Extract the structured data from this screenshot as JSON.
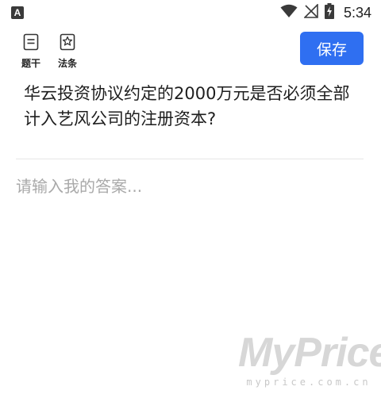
{
  "status_bar": {
    "notification_icon": "A",
    "time": "5:34",
    "icons": [
      "wifi-icon",
      "no-signal-icon",
      "battery-charging-icon"
    ]
  },
  "toolbar": {
    "tigan_label": "题干",
    "fatiao_label": "法条",
    "save_label": "保存"
  },
  "question": {
    "text": "华云投资协议约定的2000万元是否必须全部计入艺风公司的注册资本?"
  },
  "answer": {
    "placeholder": "请输入我的答案...",
    "value": ""
  },
  "watermark": {
    "main": "MyPrice",
    "sub": "myprice.com.cn"
  },
  "colors": {
    "accent": "#2f6ff1",
    "text": "#1e1e1e",
    "placeholder": "#a9a9a9"
  }
}
